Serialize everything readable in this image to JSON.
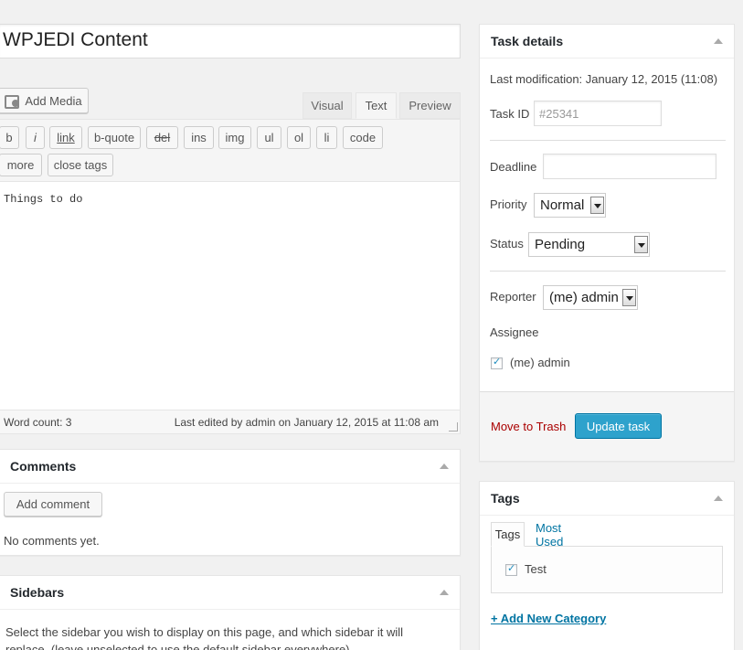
{
  "title": "WPJEDI Content",
  "media": {
    "add_media": "Add Media"
  },
  "editor_tabs": {
    "visual": "Visual",
    "text": "Text",
    "preview": "Preview"
  },
  "quicktags": {
    "row1": [
      "b",
      "i",
      "link",
      "b-quote",
      "del",
      "ins",
      "img",
      "ul",
      "ol",
      "li",
      "code"
    ],
    "row2": [
      "more",
      "close tags"
    ]
  },
  "editor": {
    "content": "Things to do",
    "word_count": "Word count: 3",
    "last_edited": "Last edited by admin on January 12, 2015 at 11:08 am"
  },
  "comments": {
    "title": "Comments",
    "add_button": "Add comment",
    "empty": "No comments yet."
  },
  "sidebars": {
    "title": "Sidebars",
    "description": "Select the sidebar you wish to display on this page, and which sidebar it will replace. (leave unselected to use the default sidebar everywhere)"
  },
  "task_details": {
    "title": "Task details",
    "last_modification": "Last modification: January 12, 2015 (11:08)",
    "task_id_label": "Task ID",
    "task_id_placeholder": "#25341",
    "deadline_label": "Deadline",
    "deadline_value": "",
    "priority_label": "Priority",
    "priority_value": "Normal",
    "status_label": "Status",
    "status_value": "Pending",
    "reporter_label": "Reporter",
    "reporter_value": "(me) admin",
    "assignee_label": "Assignee",
    "assignee_option": "(me) admin",
    "move_to_trash": "Move to Trash",
    "update_button": "Update task"
  },
  "tags": {
    "title": "Tags",
    "tab_tags": "Tags",
    "tab_most_used": "Most Used",
    "items": [
      "Test"
    ],
    "add_new": "+ Add New Category"
  },
  "colors": {
    "primary": "#2ea2cc",
    "link": "#0074a2",
    "trash": "#aa0000",
    "background": "#f1f1f1"
  }
}
